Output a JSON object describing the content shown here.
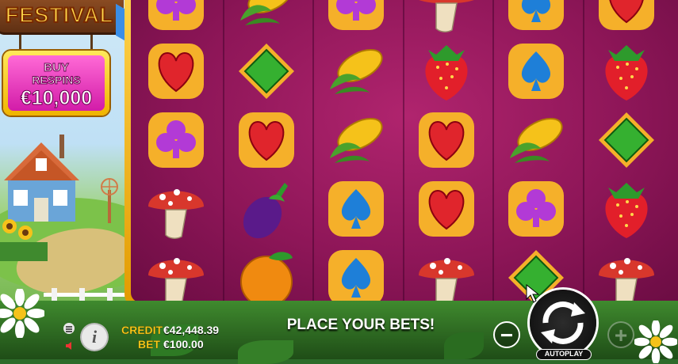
{
  "game": {
    "title": "FESTIVAL",
    "buy_button": {
      "line1": "BUY",
      "line2": "RESPINS",
      "line3": "€10,000"
    }
  },
  "reels": {
    "columns": [
      [
        "club-symbol",
        "heart-symbol",
        "club-symbol",
        "mushroom-symbol",
        "mushroom-symbol"
      ],
      [
        "corn-symbol",
        "diamond-symbol",
        "heart-symbol",
        "eggplant-symbol",
        "orange-symbol"
      ],
      [
        "club-symbol",
        "corn-symbol",
        "corn-symbol",
        "spade-symbol",
        "spade-symbol"
      ],
      [
        "mushroom-symbol",
        "strawberry-symbol",
        "heart-symbol",
        "heart-symbol",
        "mushroom-symbol"
      ],
      [
        "spade-symbol",
        "spade-symbol",
        "corn-symbol",
        "club-symbol",
        "diamond-symbol"
      ],
      [
        "heart-symbol",
        "strawberry-symbol",
        "diamond-symbol",
        "strawberry-symbol",
        "mushroom-symbol"
      ]
    ]
  },
  "bottom_bar": {
    "credit_label": "CREDIT",
    "credit_value": "€42,448.39",
    "bet_label": "BET",
    "bet_value": "€100.00",
    "status_message": "PLACE YOUR BETS!",
    "autoplay_label": "AUTOPLAY",
    "minus_label": "−",
    "plus_label": "+",
    "info_label": "i"
  },
  "colors": {
    "reel_background": "#8e1658",
    "frame_gold": "#ffd34a",
    "credit_label_color": "#ffcf1a"
  }
}
